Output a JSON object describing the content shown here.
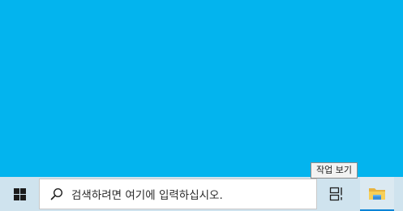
{
  "taskbar": {
    "search": {
      "placeholder": "검색하려면 여기에 입력하십시오."
    },
    "task_view": {
      "tooltip": "작업 보기"
    }
  },
  "icons": {
    "start": "windows-logo-icon",
    "search": "search-icon",
    "task_view": "task-view-icon",
    "explorer": "file-explorer-icon"
  },
  "colors": {
    "desktop": "#03b4ee",
    "taskbar": "#cfe3ee",
    "active_indicator": "#0a84d6"
  }
}
